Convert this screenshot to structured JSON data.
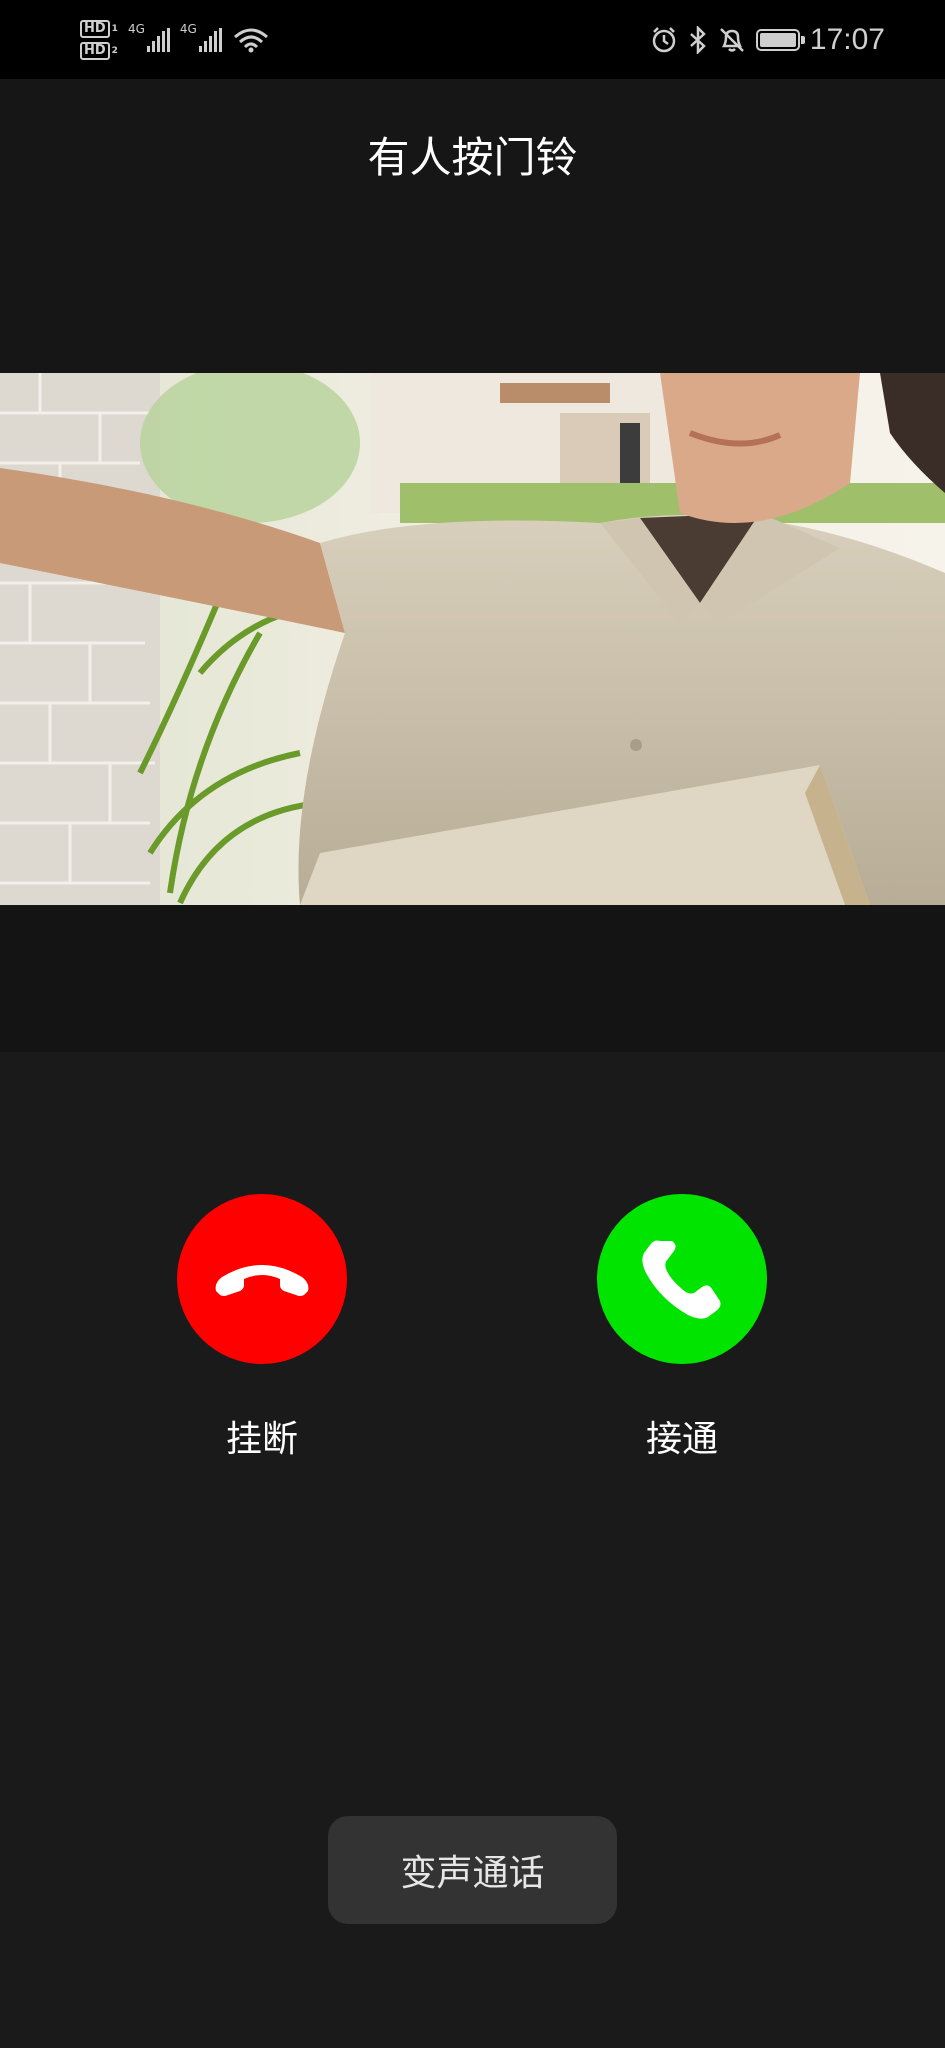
{
  "status_bar": {
    "sim1": "HD",
    "sim1_index": "1",
    "sim2": "HD",
    "sim2_index": "2",
    "network1": "4G",
    "network2": "4G",
    "time": "17:07",
    "icons": [
      "alarm-icon",
      "bluetooth-icon",
      "mute-icon",
      "battery-icon"
    ]
  },
  "header": {
    "title": "有人按门铃"
  },
  "camera_feed": {
    "description_icon": "doorbell-camera-image"
  },
  "actions": {
    "hangup_label": "挂断",
    "answer_label": "接通",
    "hangup_color": "#ff0000",
    "answer_color": "#00e400"
  },
  "voice_change": {
    "label": "变声通话"
  }
}
